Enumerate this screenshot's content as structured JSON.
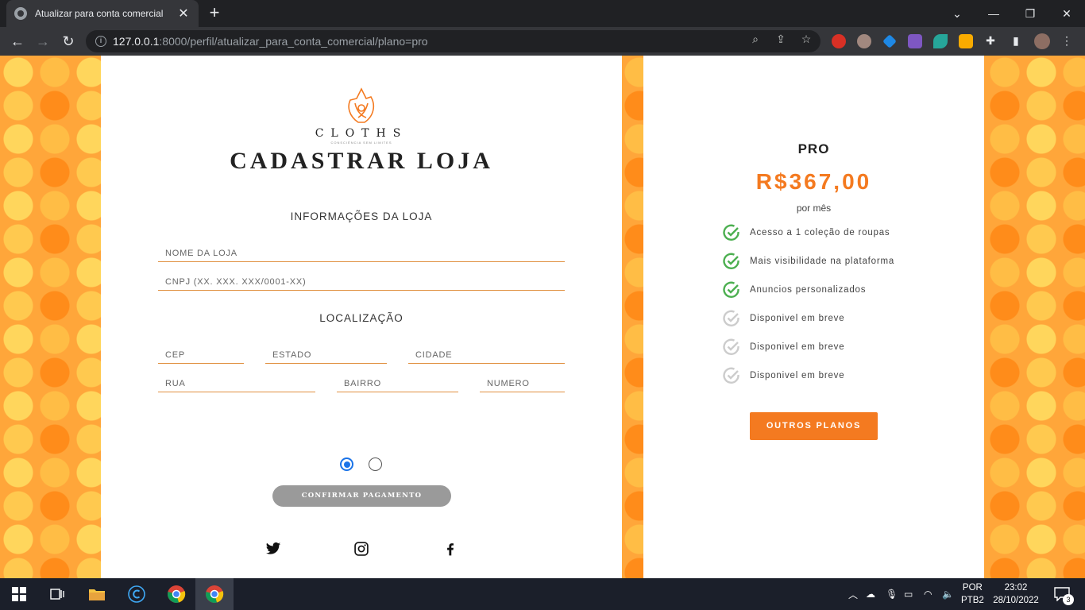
{
  "browser": {
    "tab_title": "Atualizar para conta comercial",
    "url_host": "127.0.0.1",
    "url_rest": ":8000/perfil/atualizar_para_conta_comercial/plano=pro",
    "new_tab": "+",
    "close_tab": "✕"
  },
  "form": {
    "brand": "CLOTHS",
    "brand_tagline": "CONSCIÊNCIA SEM LIMITES",
    "title": "CADASTRAR LOJA",
    "store_section": "INFORMAÇÕES DA LOJA",
    "store_name_placeholder": "NOME DA LOJA",
    "cnpj_placeholder": "CNPJ (XX. XXX. XXX/0001-XX)",
    "location_section": "LOCALIZAÇÃO",
    "cep_placeholder": "CEP",
    "estado_placeholder": "ESTADO",
    "cidade_placeholder": "CIDADE",
    "rua_placeholder": "RUA",
    "bairro_placeholder": "BAIRRO",
    "numero_placeholder": "NUMERO",
    "confirm_label": "CONFIRMAR PAGAMENTO"
  },
  "plan": {
    "name": "PRO",
    "price": "R$367,00",
    "period": "por mês",
    "features": [
      {
        "label": "Acesso a 1 coleção de roupas",
        "active": true
      },
      {
        "label": "Mais visibilidade na plataforma",
        "active": true
      },
      {
        "label": "Anuncios personalizados",
        "active": true
      },
      {
        "label": "Disponivel em breve",
        "active": false
      },
      {
        "label": "Disponivel em breve",
        "active": false
      },
      {
        "label": "Disponivel em breve",
        "active": false
      }
    ],
    "other_plans_label": "OUTROS PLANOS"
  },
  "colors": {
    "accent": "#f47a20",
    "check_active": "#4caf50",
    "check_inactive": "#cccccc"
  },
  "taskbar": {
    "lang_top": "POR",
    "lang_bottom": "PTB2",
    "time": "23:02",
    "date": "28/10/2022",
    "notifications": "3"
  }
}
